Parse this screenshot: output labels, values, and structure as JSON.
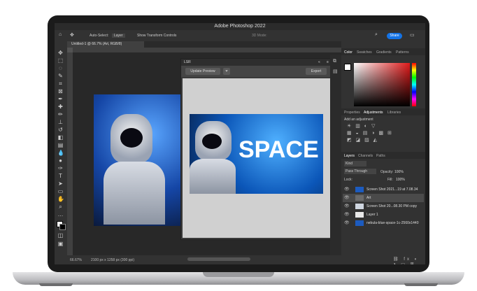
{
  "app": {
    "title": "Adobe Photoshop 2022",
    "share_label": "Share"
  },
  "options_bar": {
    "auto_select": "Auto-Select:",
    "auto_select_value": "Layer",
    "transform_controls": "Show Transform Controls",
    "mode_3d": "3D Mode:"
  },
  "document_tab": {
    "label": "Untitled-1 @ 66.7% (Art, RGB/8)"
  },
  "status": {
    "zoom": "66.67%",
    "dimensions": "2100 px x 1258 px (300 ppi)"
  },
  "lsr_panel": {
    "title": "LSR",
    "update_preview": "Update Preview",
    "export": "Export",
    "banner_text": "SPACE"
  },
  "color_panel": {
    "tabs": [
      "Color",
      "Swatches",
      "Gradients",
      "Patterns"
    ]
  },
  "adjust_panel": {
    "tabs": [
      "Properties",
      "Adjustments",
      "Libraries"
    ],
    "hint": "Add an adjustment"
  },
  "layers_panel": {
    "tabs": [
      "Layers",
      "Channels",
      "Paths"
    ],
    "filter": "Kind",
    "blend_mode": "Pass Through",
    "opacity_label": "Opacity:",
    "opacity_value": "100%",
    "lock_label": "Lock:",
    "fill_label": "Fill:",
    "fill_value": "100%",
    "layers": [
      {
        "name": "Screen Shot 2021...19 at 7.08.34 PM"
      },
      {
        "name": "Art"
      },
      {
        "name": "Screen Shot 20...08.30 PM copy"
      },
      {
        "name": "Layer 1"
      },
      {
        "name": "nebula-blue-space-1c-2560x1440"
      }
    ]
  },
  "colors": {
    "accent": "#1473e6",
    "panel_bg": "#323232",
    "canvas": "#282828"
  }
}
